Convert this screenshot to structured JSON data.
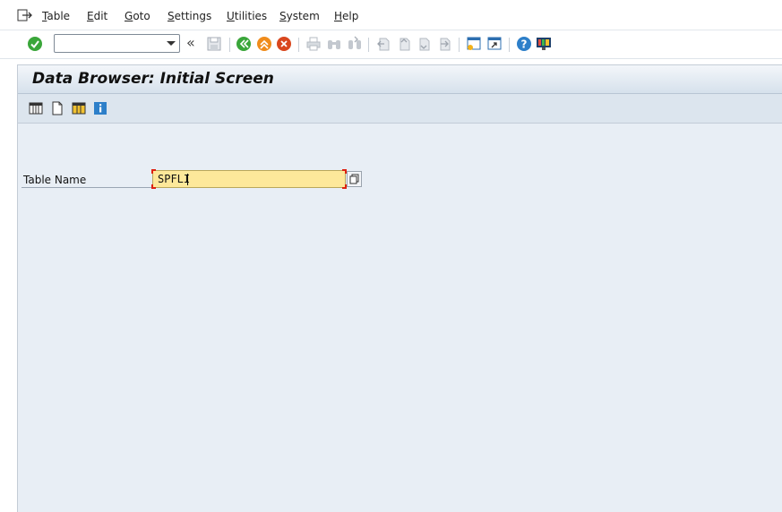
{
  "menu": {
    "items": [
      {
        "mnemonic": "T",
        "rest": "able"
      },
      {
        "mnemonic": "E",
        "rest": "dit"
      },
      {
        "mnemonic": "G",
        "rest": "oto"
      },
      {
        "mnemonic": "S",
        "rest": "ettings"
      },
      {
        "mnemonic": "U",
        "rest": "tilities"
      },
      {
        "mnemonic": "S",
        "rest": "ystem"
      },
      {
        "mnemonic": "H",
        "rest": "elp"
      }
    ]
  },
  "toolbar": {
    "command_value": "",
    "back_chevron": "«"
  },
  "screen": {
    "title": "Data Browser: Initial Screen",
    "field_label": "Table Name",
    "field_value": "SPFLI"
  },
  "colors": {
    "accent_green": "#3aa63a",
    "accent_orange": "#f08c1c",
    "accent_red": "#d9471e",
    "required_field_bg": "#fde89a",
    "content_bg": "#e8eef5"
  }
}
